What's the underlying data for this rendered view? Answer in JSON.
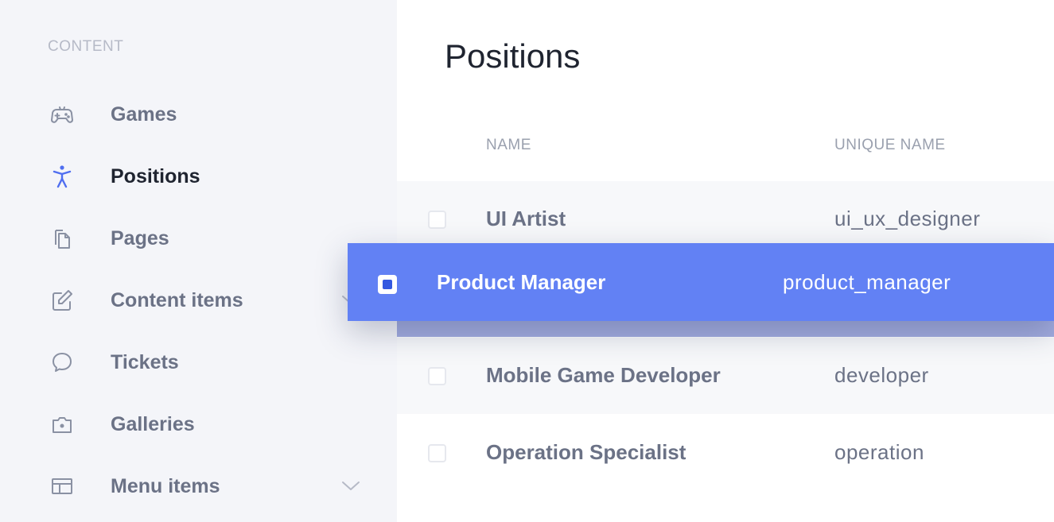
{
  "sidebar": {
    "section_label": "CONTENT",
    "items": [
      {
        "label": "Games",
        "icon": "gamepad-icon"
      },
      {
        "label": "Positions",
        "icon": "person-icon",
        "active": true
      },
      {
        "label": "Pages",
        "icon": "pages-icon"
      },
      {
        "label": "Content items",
        "icon": "edit-icon",
        "has_chevron": true
      },
      {
        "label": "Tickets",
        "icon": "chat-bubble-icon"
      },
      {
        "label": "Galleries",
        "icon": "camera-icon"
      },
      {
        "label": "Menu items",
        "icon": "menu-window-icon",
        "has_chevron": true
      }
    ]
  },
  "main": {
    "title": "Positions",
    "columns": {
      "name": "NAME",
      "unique_name": "UNIQUE NAME"
    },
    "rows": [
      {
        "name": "UI Artist",
        "unique_name": "ui_ux_designer"
      },
      {
        "name": "Mobile Game Developer",
        "unique_name": "developer"
      },
      {
        "name": "Operation Specialist",
        "unique_name": "operation"
      }
    ],
    "dragging_row": {
      "name": "Product Manager",
      "unique_name": "product_manager",
      "checked": true
    }
  },
  "colors": {
    "accent": "#6281f4",
    "active_icon": "#4f6ef0",
    "sidebar_bg": "#f4f5f9",
    "drop_placeholder": "#a2acdf"
  }
}
